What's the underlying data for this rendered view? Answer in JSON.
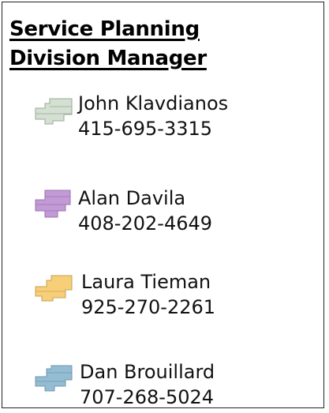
{
  "legend": {
    "title_line1": "Service Planning",
    "title_line2": "Division Manager",
    "entries": [
      {
        "name": "John Klavdianos",
        "phone": "415-695-3315",
        "color": "#d4e0d1",
        "stroke": "#9aa89a",
        "icon": "territory-swatch-icon"
      },
      {
        "name": "Alan Davila",
        "phone": "408-202-4649",
        "color": "#c29ad6",
        "stroke": "#9a72ad",
        "icon": "territory-swatch-icon"
      },
      {
        "name": "Laura Tieman",
        "phone": "925-270-2261",
        "color": "#f7cf78",
        "stroke": "#c6a052",
        "icon": "territory-swatch-icon"
      },
      {
        "name": "Dan Brouillard",
        "phone": "707-268-5024",
        "color": "#94bcd3",
        "stroke": "#6f97ad",
        "icon": "territory-swatch-icon"
      }
    ]
  }
}
